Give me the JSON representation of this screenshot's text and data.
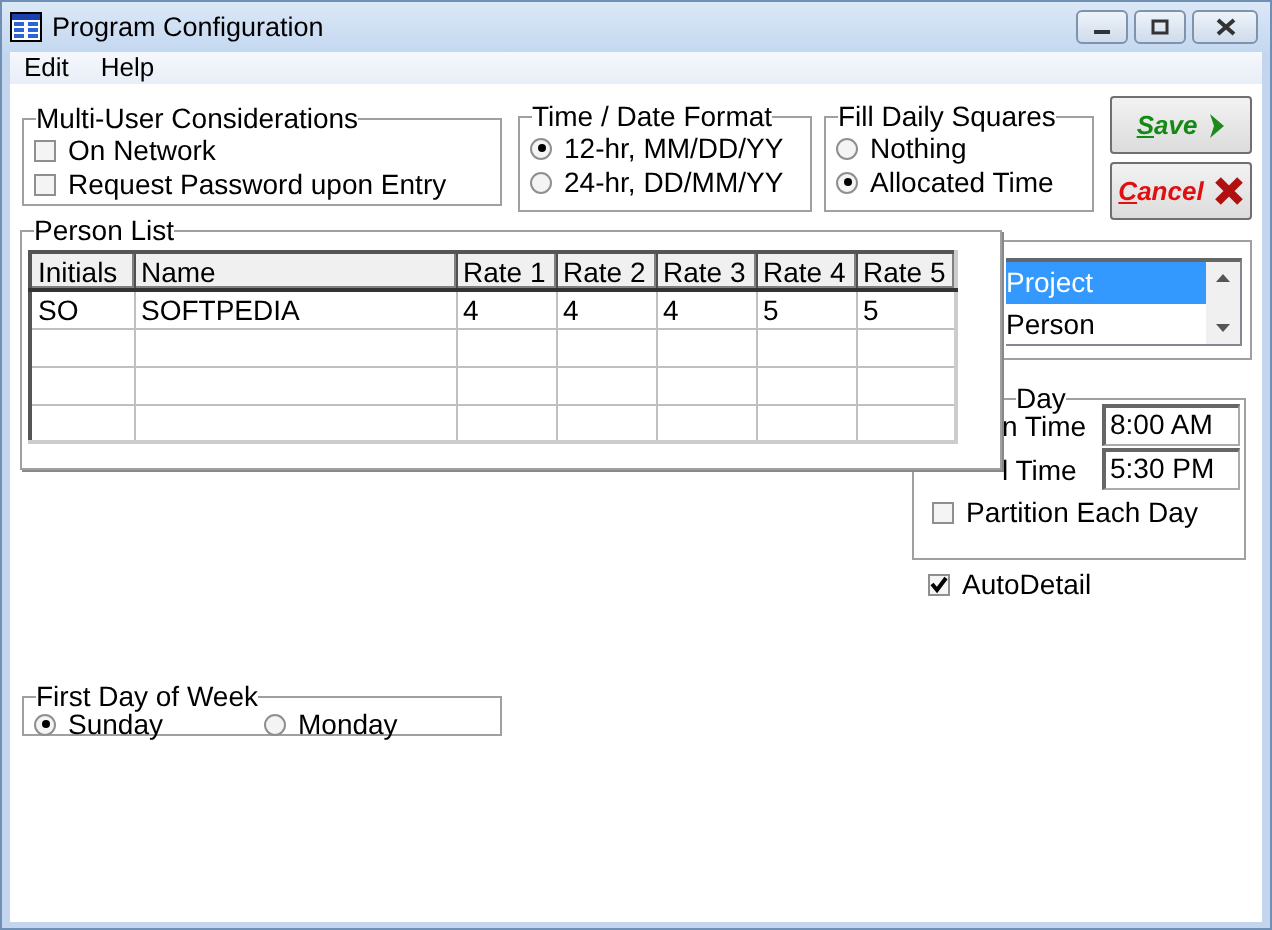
{
  "window": {
    "title": "Program Configuration"
  },
  "menu": [
    {
      "label": "Edit"
    },
    {
      "label": "Help"
    }
  ],
  "multi_user": {
    "title": "Multi-User Considerations",
    "options": [
      {
        "label": "On Network",
        "checked": false
      },
      {
        "label": "Request Password upon Entry",
        "checked": false
      }
    ]
  },
  "time_date_format": {
    "title": "Time / Date Format",
    "options": [
      {
        "label": "12-hr, MM/DD/YY",
        "selected": true
      },
      {
        "label": "24-hr, DD/MM/YY",
        "selected": false
      }
    ]
  },
  "fill_daily_squares": {
    "title": "Fill Daily Squares",
    "options": [
      {
        "label": "Nothing",
        "selected": false
      },
      {
        "label": "Allocated Time",
        "selected": true
      }
    ]
  },
  "buttons": [
    {
      "label": "Save",
      "kind": "save"
    },
    {
      "label": "Cancel",
      "kind": "cancel"
    }
  ],
  "person_list": {
    "title": "Person List",
    "columns": [
      "Initials",
      "Name",
      "Rate 1",
      "Rate 2",
      "Rate 3",
      "Rate 4",
      "Rate 5"
    ],
    "rows": [
      [
        "SO",
        "SOFTPEDIA",
        "4",
        "4",
        "4",
        "5",
        "5"
      ]
    ]
  },
  "list": {
    "items": [
      {
        "label": "Project",
        "selected": true
      },
      {
        "label": "Person",
        "selected": false
      }
    ]
  },
  "day": {
    "title": "Day",
    "fields": [
      {
        "label": "n Time",
        "value": "8:00 AM"
      },
      {
        "label": "l Time",
        "value": "5:30 PM"
      }
    ],
    "options": [
      {
        "label": "Partition Each Day",
        "checked": false
      }
    ]
  },
  "auto_detail": {
    "label": "AutoDetail",
    "checked": true
  },
  "first_day_of_week": {
    "title": "First Day of Week",
    "options": [
      {
        "label": "Sunday",
        "selected": true
      },
      {
        "label": "Monday",
        "selected": false
      }
    ]
  }
}
